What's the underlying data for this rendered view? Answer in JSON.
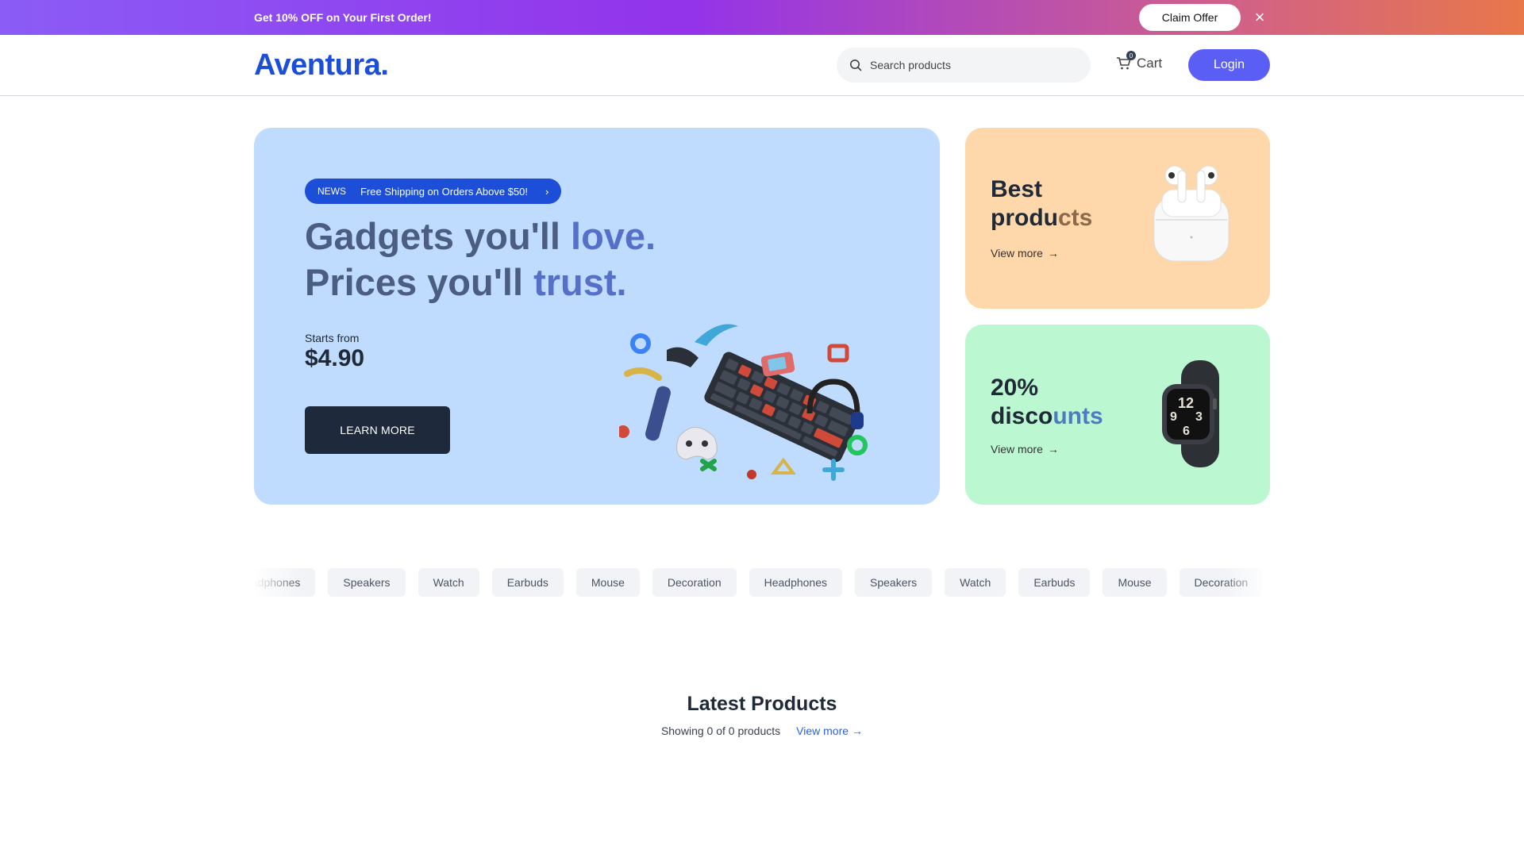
{
  "promo": {
    "text": "Get 10% OFF on Your First Order!",
    "claim_label": "Claim Offer",
    "close_icon": "×"
  },
  "header": {
    "logo_text": "Aventura",
    "logo_dot": ".",
    "search_placeholder": "Search products",
    "cart_label": "Cart",
    "cart_count": "0",
    "login_label": "Login"
  },
  "hero": {
    "news_tag": "NEWS",
    "news_text": "Free Shipping on Orders Above $50!",
    "headline_1a": "Gadgets you'll ",
    "headline_1b": "love.",
    "headline_2a": "Prices you'll ",
    "headline_2b": "trust.",
    "starts_label": "Starts from",
    "price": "$4.90",
    "cta_label": "LEARN MORE"
  },
  "side_cards": [
    {
      "title_a": "Best",
      "title_b": "produ",
      "title_c": "cts",
      "link": "View more"
    },
    {
      "title_a": "20%",
      "title_b": "disco",
      "title_c": "unts",
      "link": "View more"
    }
  ],
  "categories": [
    "Headphones",
    "Speakers",
    "Watch",
    "Earbuds",
    "Mouse",
    "Decoration",
    "Headphones",
    "Speakers",
    "Watch",
    "Earbuds",
    "Mouse",
    "Decoration"
  ],
  "latest": {
    "title": "Latest Products",
    "showing": "Showing 0 of 0 products",
    "view_more": "View more"
  },
  "colors": {
    "accent": "#5b5ef5",
    "brand": "#1d4ed8",
    "hero_bg": "#bfdbfe",
    "card_orange": "#fed7aa",
    "card_green": "#bbf7d0"
  }
}
